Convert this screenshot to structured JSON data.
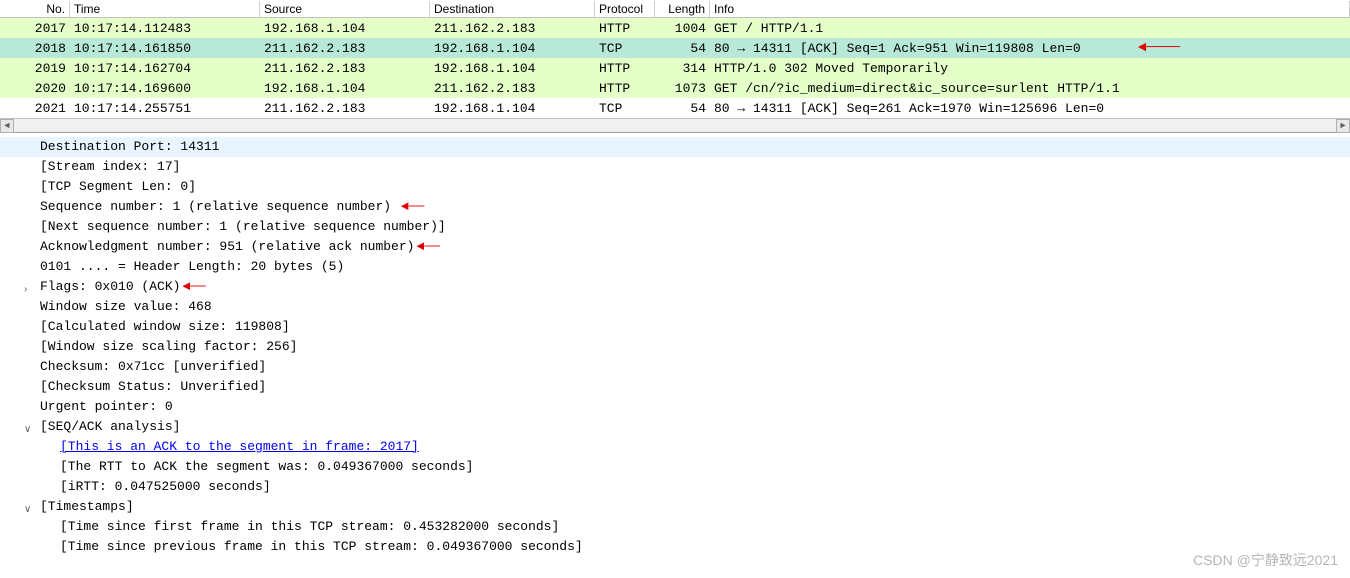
{
  "columns": {
    "no": "No.",
    "time": "Time",
    "source": "Source",
    "dest": "Destination",
    "proto": "Protocol",
    "length": "Length",
    "info": "Info"
  },
  "packets": [
    {
      "no": "2017",
      "time": "10:17:14.112483",
      "source": "192.168.1.104",
      "dest": "211.162.2.183",
      "proto": "HTTP",
      "length": "1004",
      "info": "GET / HTTP/1.1",
      "cls": "http"
    },
    {
      "no": "2018",
      "time": "10:17:14.161850",
      "source": "211.162.2.183",
      "dest": "192.168.1.104",
      "proto": "TCP",
      "length": "54",
      "info": "80 → 14311 [ACK] Seq=1 Ack=951 Win=119808 Len=0",
      "cls": "tcp-selected",
      "arrow": true
    },
    {
      "no": "2019",
      "time": "10:17:14.162704",
      "source": "211.162.2.183",
      "dest": "192.168.1.104",
      "proto": "HTTP",
      "length": "314",
      "info": "HTTP/1.0 302 Moved Temporarily",
      "cls": "http"
    },
    {
      "no": "2020",
      "time": "10:17:14.169600",
      "source": "192.168.1.104",
      "dest": "211.162.2.183",
      "proto": "HTTP",
      "length": "1073",
      "info": "GET /cn/?ic_medium=direct&ic_source=surlent HTTP/1.1",
      "cls": "http"
    },
    {
      "no": "2021",
      "time": "10:17:14.255751",
      "source": "211.162.2.183",
      "dest": "192.168.1.104",
      "proto": "TCP",
      "length": "54",
      "info": "80 → 14311 [ACK] Seq=261 Ack=1970 Win=125696 Len=0",
      "cls": "tcp"
    }
  ],
  "details": {
    "dest_port": "Destination Port: 14311",
    "stream_index": "[Stream index: 17]",
    "tcp_seg_len": "[TCP Segment Len: 0]",
    "seq_num": "Sequence number: 1    (relative sequence number)",
    "next_seq": "[Next sequence number: 1    (relative sequence number)]",
    "ack_num": "Acknowledgment number: 951    (relative ack number)",
    "header_len": "0101 .... = Header Length: 20 bytes (5)",
    "flags": "Flags: 0x010 (ACK)",
    "win_size": "Window size value: 468",
    "calc_win": "[Calculated window size: 119808]",
    "win_scale": "[Window size scaling factor: 256]",
    "checksum": "Checksum: 0x71cc [unverified]",
    "checksum_status": "[Checksum Status: Unverified]",
    "urgent": "Urgent pointer: 0",
    "seq_ack_analysis": "[SEQ/ACK analysis]",
    "ack_link": "[This is an ACK to the segment in frame: 2017]",
    "rtt": "[The RTT to ACK the segment was: 0.049367000 seconds]",
    "irtt": "[iRTT: 0.047525000 seconds]",
    "timestamps": "[Timestamps]",
    "time_first": "[Time since first frame in this TCP stream: 0.453282000 seconds]",
    "time_prev": "[Time since previous frame in this TCP stream: 0.049367000 seconds]"
  },
  "watermark": "CSDN @宁静致远2021"
}
